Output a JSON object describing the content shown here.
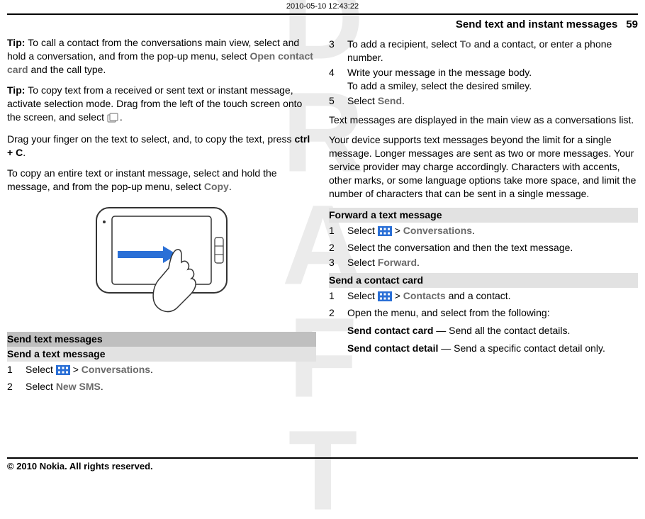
{
  "timestamp": "2010-05-10 12:43:22",
  "watermark": "DRAFT",
  "header": {
    "title": "Send text and instant messages",
    "page": "59"
  },
  "footer": "© 2010 Nokia. All rights reserved.",
  "left": {
    "tip1_a": "Tip: ",
    "tip1_b": "To call a contact from the conversations main view, select and hold a conversation, and from the pop-up menu, select ",
    "tip1_c": "Open contact card",
    "tip1_d": " and the call type.",
    "tip2_a": "Tip: ",
    "tip2_b": "To copy text from a received or sent text or instant message, activate selection mode. Drag from the left of the touch screen onto the screen, and select ",
    "p3_a": "Drag your finger on the text to select, and, to copy the text, press ",
    "p3_b": "ctrl + C",
    "p3_c": ".",
    "p4_a": "To copy an entire text or instant message, select and hold the message, and from the pop-up menu, select ",
    "p4_b": "Copy",
    "p4_c": ".",
    "h1": "Send text messages",
    "h2": "Send a text message",
    "step1_a": "Select ",
    "step1_b": " > ",
    "step1_c": "Conversations",
    "step1_d": ".",
    "step2_a": "Select ",
    "step2_b": "New SMS",
    "step2_c": "."
  },
  "right": {
    "step3_a": "To add a recipient, select ",
    "step3_b": "To",
    "step3_c": " and a contact, or enter a phone number.",
    "step4_a": "Write your message in the message body.",
    "step4_b": "To add a smiley, select the desired smiley.",
    "step5_a": "Select ",
    "step5_b": "Send",
    "step5_c": ".",
    "p1": "Text messages are displayed in the main view as a conversations list.",
    "p2": "Your device supports text messages beyond the limit for a single message. Longer messages are sent as two or more messages. Your service provider may charge accordingly. Characters with accents, other marks, or some language options take more space, and limit the number of characters that can be sent in a single message.",
    "h_fwd": "Forward a text message",
    "fwd1_a": "Select ",
    "fwd1_b": " > ",
    "fwd1_c": "Conversations",
    "fwd1_d": ".",
    "fwd2": "Select the conversation and then the text message.",
    "fwd3_a": "Select ",
    "fwd3_b": "Forward",
    "fwd3_c": ".",
    "h_card": "Send a contact card",
    "card1_a": "Select ",
    "card1_b": " > ",
    "card1_c": "Contacts",
    "card1_d": " and a contact.",
    "card2": "Open the menu, and select from the following:",
    "opt1_a": "Send contact card ",
    "opt1_b": " — Send all the contact details.",
    "opt2_a": "Send contact detail ",
    "opt2_b": " — Send a specific contact detail only."
  }
}
